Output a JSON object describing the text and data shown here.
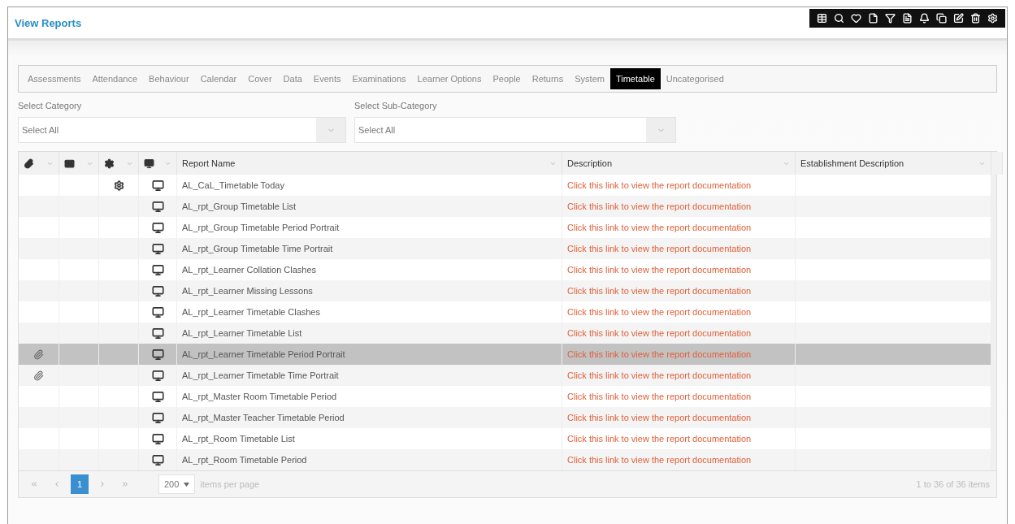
{
  "header": {
    "title": "View Reports"
  },
  "tabs": [
    {
      "label": "Assessments",
      "selected": false
    },
    {
      "label": "Attendance",
      "selected": false
    },
    {
      "label": "Behaviour",
      "selected": false
    },
    {
      "label": "Calendar",
      "selected": false
    },
    {
      "label": "Cover",
      "selected": false
    },
    {
      "label": "Data",
      "selected": false
    },
    {
      "label": "Events",
      "selected": false
    },
    {
      "label": "Examinations",
      "selected": false
    },
    {
      "label": "Learner Options",
      "selected": false
    },
    {
      "label": "People",
      "selected": false
    },
    {
      "label": "Returns",
      "selected": false
    },
    {
      "label": "System",
      "selected": false
    },
    {
      "label": "Timetable",
      "selected": true
    },
    {
      "label": "Uncategorised",
      "selected": false
    }
  ],
  "filters": [
    {
      "label": "Select Category",
      "value": "Select All"
    },
    {
      "label": "Select Sub-Category",
      "value": "Select All"
    }
  ],
  "table": {
    "columns": [
      "Report Name",
      "Description",
      "Establishment Description"
    ],
    "rows": [
      {
        "attachment": false,
        "settings": true,
        "name": "AL_CaL_Timetable Today",
        "description": "Click this link to view the report documentation",
        "selected": false
      },
      {
        "attachment": false,
        "settings": false,
        "name": "AL_rpt_Group Timetable List",
        "description": "Click this link to view the report documentation",
        "selected": false
      },
      {
        "attachment": false,
        "settings": false,
        "name": "AL_rpt_Group Timetable Period Portrait",
        "description": "Click this link to view the report documentation",
        "selected": false
      },
      {
        "attachment": false,
        "settings": false,
        "name": "AL_rpt_Group Timetable Time Portrait",
        "description": "Click this link to view the report documentation",
        "selected": false
      },
      {
        "attachment": false,
        "settings": false,
        "name": "AL_rpt_Learner Collation Clashes",
        "description": "Click this link to view the report documentation",
        "selected": false
      },
      {
        "attachment": false,
        "settings": false,
        "name": "AL_rpt_Learner Missing Lessons",
        "description": "Click this link to view the report documentation",
        "selected": false
      },
      {
        "attachment": false,
        "settings": false,
        "name": "AL_rpt_Learner Timetable Clashes",
        "description": "Click this link to view the report documentation",
        "selected": false
      },
      {
        "attachment": false,
        "settings": false,
        "name": "AL_rpt_Learner Timetable List",
        "description": "Click this link to view the report documentation",
        "selected": false
      },
      {
        "attachment": true,
        "settings": false,
        "name": "AL_rpt_Learner Timetable Period Portrait",
        "description": "Click this link to view the report documentation",
        "selected": true
      },
      {
        "attachment": true,
        "settings": false,
        "name": "AL_rpt_Learner Timetable Time Portrait",
        "description": "Click this link to view the report documentation",
        "selected": false
      },
      {
        "attachment": false,
        "settings": false,
        "name": "AL_rpt_Master Room Timetable Period",
        "description": "Click this link to view the report documentation",
        "selected": false
      },
      {
        "attachment": false,
        "settings": false,
        "name": "AL_rpt_Master Teacher Timetable Period",
        "description": "Click this link to view the report documentation",
        "selected": false
      },
      {
        "attachment": false,
        "settings": false,
        "name": "AL_rpt_Room Timetable List",
        "description": "Click this link to view the report documentation",
        "selected": false
      },
      {
        "attachment": false,
        "settings": false,
        "name": "AL_rpt_Room Timetable Period",
        "description": "Click this link to view the report documentation",
        "selected": false
      }
    ]
  },
  "pager": {
    "page": "1",
    "page_size": "200",
    "page_size_label": "items per page",
    "summary": "1 to 36 of 36 items"
  }
}
